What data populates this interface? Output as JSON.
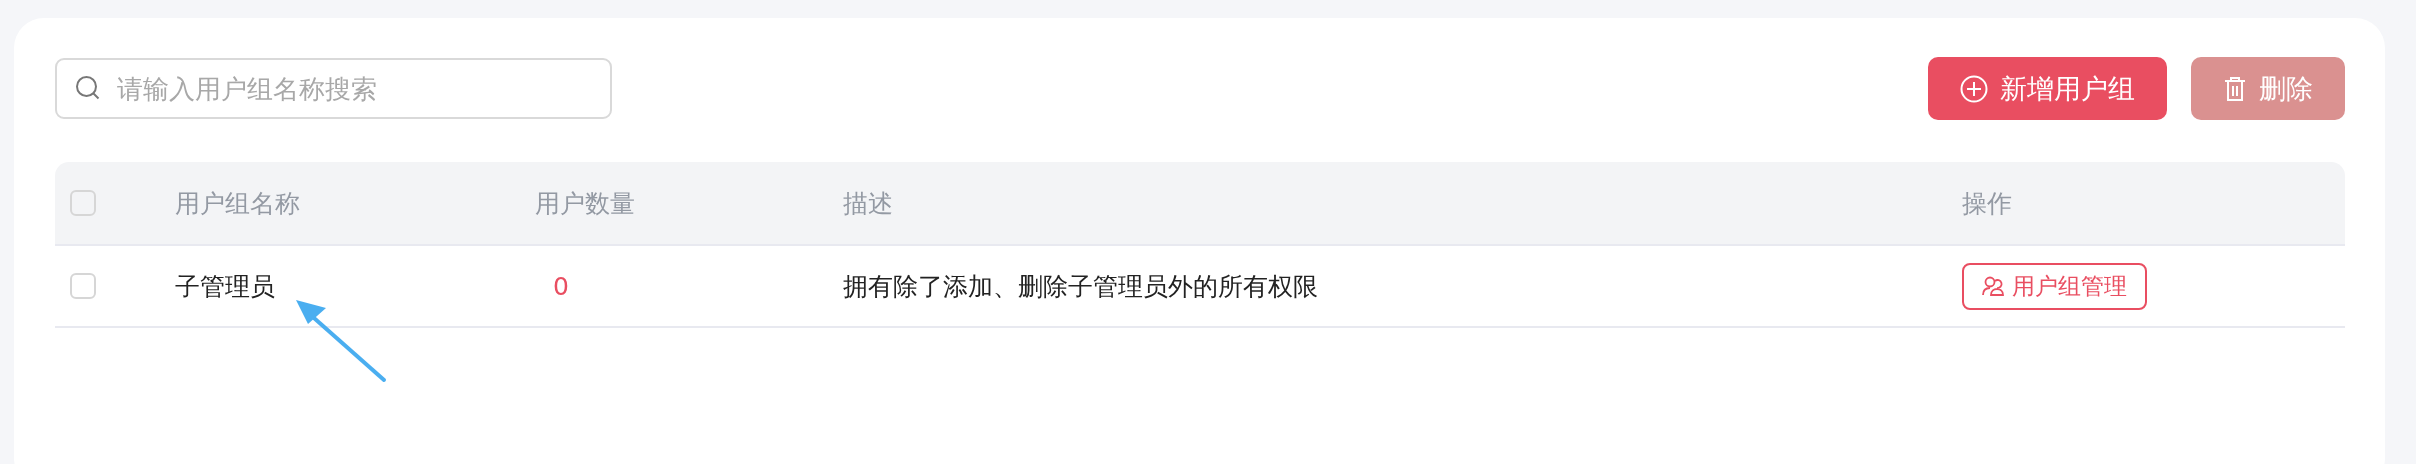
{
  "search": {
    "placeholder": "请输入用户组名称搜索"
  },
  "buttons": [
    {
      "kind": "add",
      "label": "新增用户组",
      "disabled": false
    },
    {
      "kind": "delete",
      "label": "删除",
      "disabled": true
    }
  ],
  "table": {
    "header_checkbox": {
      "checked": false
    },
    "columns": [
      "用户组名称",
      "用户数量",
      "描述",
      "操作"
    ],
    "rows": [
      {
        "checked": false,
        "name": "子管理员",
        "count": "0",
        "description": "拥有除了添加、删除子管理员外的所有权限",
        "action": "用户组管理"
      }
    ]
  },
  "annotation": {
    "kind": "arrow"
  }
}
